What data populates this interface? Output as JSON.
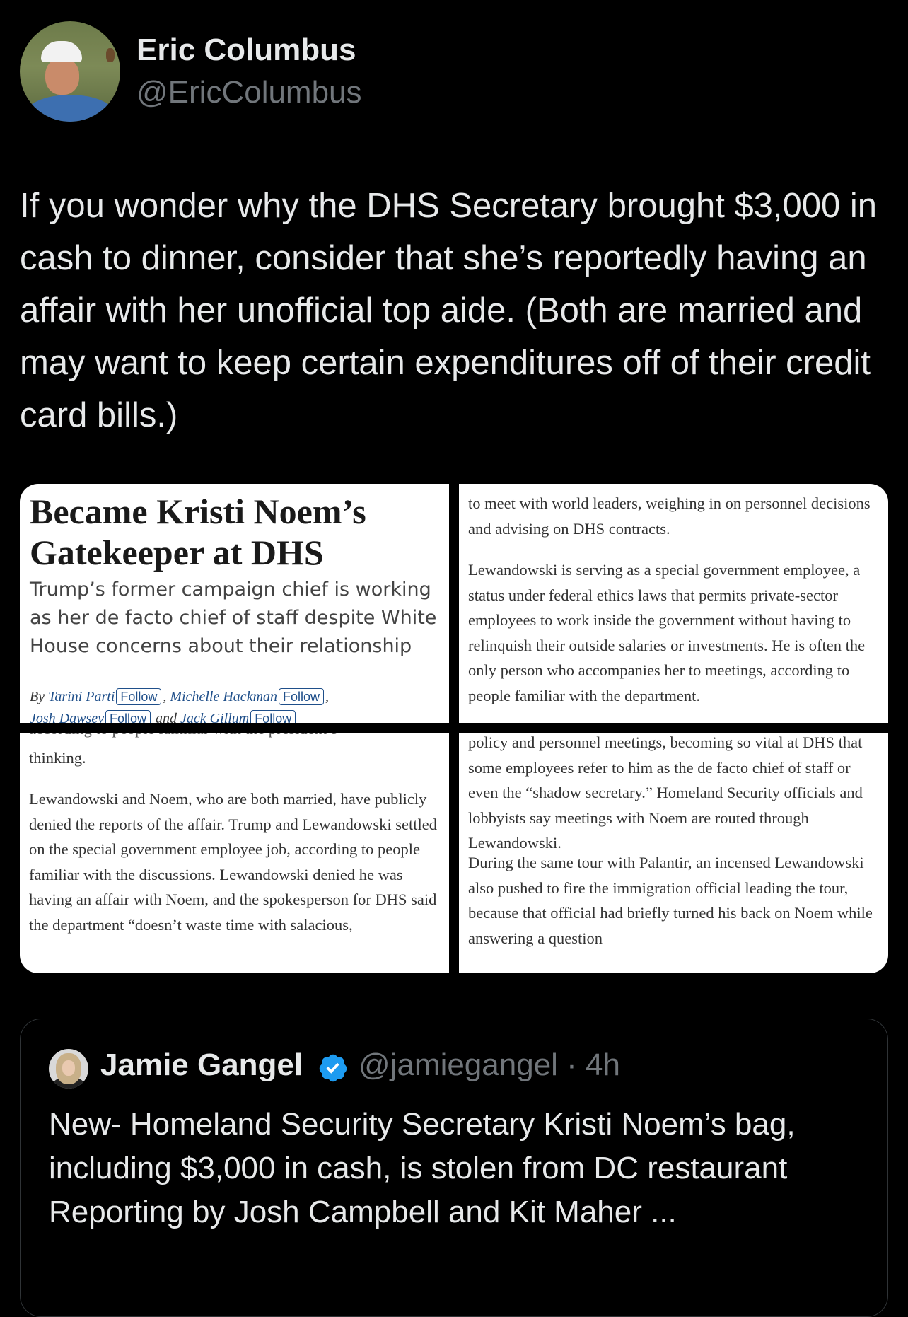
{
  "author": {
    "name": "Eric Columbus",
    "handle": "@EricColumbus"
  },
  "tweet_text": "If you wonder why the DHS Secretary brought $3,000 in cash to dinner, consider that she’s reportedly having an affair with her unofficial top aide. (Both are married and may want to keep certain expenditures off of their credit card bills.)",
  "media": {
    "panel1": {
      "headline": "Became Kristi Noem’s Gatekeeper at DHS",
      "dek": "Trump’s former campaign chief is working as her de facto chief of staff despite White House concerns about their relationship",
      "by": "By",
      "author1": "Tarini Parti",
      "author2": "Michelle Hackman",
      "author3": "Josh Dawsey",
      "and": "and",
      "author4": "Jack Gillum",
      "follow": "Follow"
    },
    "panel2": {
      "para1": "to meet with world leaders, weighing in on personnel decisions and advising on DHS contracts.",
      "para2": "Lewandowski is serving as a special government employee, a status under federal ethics laws that permits private-sector employees to work inside the government without having to relinquish their outside salaries or investments. He is often the only person who accompanies her to meetings, according to people familiar with the department."
    },
    "panel3": {
      "cut": "according to people familiar with the president’s",
      "para1": "thinking.",
      "para2": "Lewandowski and Noem, who are both married, have publicly denied the reports of the affair. Trump and Lewandowski settled on the special government employee job, according to people familiar with the discussions. Lewandowski denied he was having an affair with Noem, and the spokesperson for DHS said the department “doesn’t waste time with salacious,"
    },
    "panel4": {
      "para1": "policy and personnel meetings, becoming so vital at DHS that some employees refer to him as the de facto chief of staff or even the “shadow secretary.” Homeland Security officials and lobbyists say meetings with Noem are routed through Lewandowski.",
      "para2": "During the same tour with Palantir, an incensed Lewandowski also pushed to fire the immigration official leading the tour, because that official had briefly turned his back on Noem while answering a question"
    }
  },
  "quoted_tweet": {
    "name": "Jamie Gangel",
    "handle": "@jamiegangel · 4h",
    "text_line1": "New- Homeland Security Secretary Kristi Noem’s bag, including $3,000 in cash, is stolen from DC restaurant",
    "text_line2": "Reporting by Josh Campbell and Kit Maher ...",
    "verified_color": "#1d9bf0"
  },
  "icons": [
    "verified-badge-icon"
  ]
}
